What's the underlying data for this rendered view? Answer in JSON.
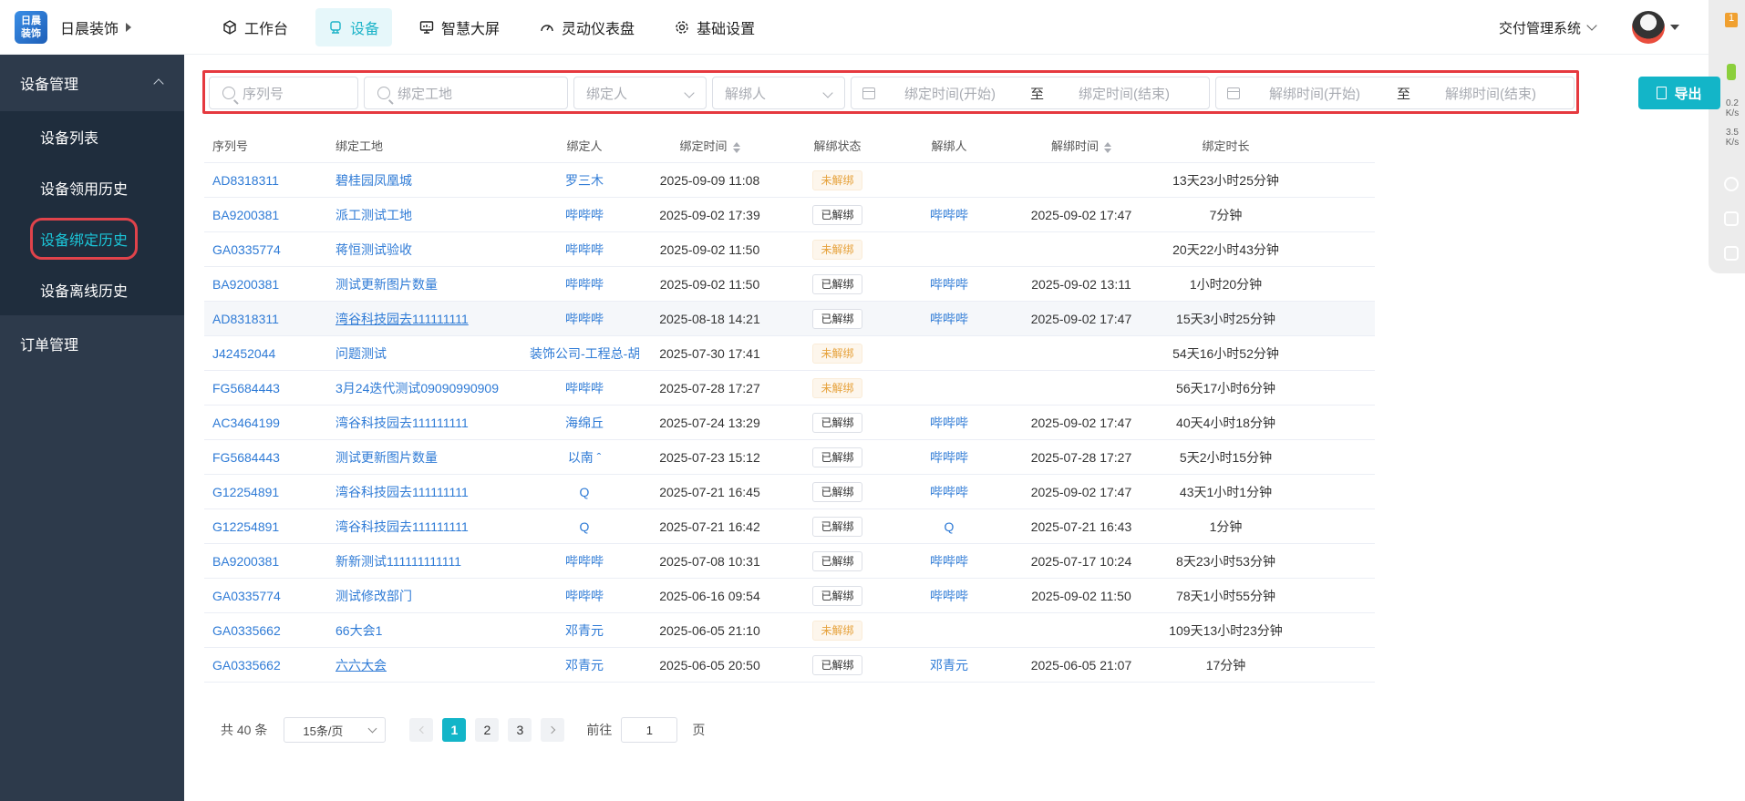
{
  "brand": {
    "name": "日晨装饰",
    "logo_text_1": "日晨",
    "logo_text_2": "装饰"
  },
  "nav": [
    {
      "label": "工作台",
      "icon": "cube-icon"
    },
    {
      "label": "设备",
      "icon": "device-icon",
      "active": true
    },
    {
      "label": "智慧大屏",
      "icon": "monitor-icon"
    },
    {
      "label": "灵动仪表盘",
      "icon": "gauge-icon"
    },
    {
      "label": "基础设置",
      "icon": "gear-icon"
    }
  ],
  "system_switch": "交付管理系统",
  "side_widget": {
    "badge": "1",
    "up_speed": "0.2",
    "up_unit": "K/s",
    "down_speed": "3.5",
    "down_unit": "K/s"
  },
  "sidebar": {
    "group1": "设备管理",
    "items": [
      "设备列表",
      "设备领用历史",
      "设备绑定历史",
      "设备离线历史"
    ],
    "group2": "订单管理"
  },
  "filters": {
    "serial_placeholder": "序列号",
    "site_placeholder": "绑定工地",
    "binder_placeholder": "绑定人",
    "unbinder_placeholder": "解绑人",
    "bind_start": "绑定时间(开始)",
    "bind_sep": "至",
    "bind_end": "绑定时间(结束)",
    "unbind_start": "解绑时间(开始)",
    "unbind_sep": "至",
    "unbind_end": "解绑时间(结束)"
  },
  "export_label": "导出",
  "table": {
    "headers": [
      "序列号",
      "绑定工地",
      "绑定人",
      "绑定时间",
      "解绑状态",
      "解绑人",
      "解绑时间",
      "绑定时长"
    ],
    "rows": [
      [
        "AD8318311",
        "碧桂园凤凰城",
        "罗三木",
        "2025-09-09 11:08",
        "未解绑",
        "",
        "",
        "13天23小时25分钟"
      ],
      [
        "BA9200381",
        "派工测试工地",
        "哔哔哔",
        "2025-09-02 17:39",
        "已解绑",
        "哔哔哔",
        "2025-09-02 17:47",
        "7分钟"
      ],
      [
        "GA0335774",
        "蒋恒测试验收",
        "哔哔哔",
        "2025-09-02 11:50",
        "未解绑",
        "",
        "",
        "20天22小时43分钟"
      ],
      [
        "BA9200381",
        "测试更新图片数量",
        "哔哔哔",
        "2025-09-02 11:50",
        "已解绑",
        "哔哔哔",
        "2025-09-02 13:11",
        "1小时20分钟"
      ],
      [
        "AD8318311",
        "湾谷科技园去111111111",
        "哔哔哔",
        "2025-08-18 14:21",
        "已解绑",
        "哔哔哔",
        "2025-09-02 17:47",
        "15天3小时25分钟"
      ],
      [
        "J42452044",
        "问题测试",
        "装饰公司-工程总-胡承仁",
        "2025-07-30 17:41",
        "未解绑",
        "",
        "",
        "54天16小时52分钟"
      ],
      [
        "FG5684443",
        "3月24迭代测试09090990909",
        "哔哔哔",
        "2025-07-28 17:27",
        "未解绑",
        "",
        "",
        "56天17小时6分钟"
      ],
      [
        "AC3464199",
        "湾谷科技园去111111111",
        "海绵丘",
        "2025-07-24 13:29",
        "已解绑",
        "哔哔哔",
        "2025-09-02 17:47",
        "40天4小时18分钟"
      ],
      [
        "FG5684443",
        "测试更新图片数量",
        "以南 ˆ",
        "2025-07-23 15:12",
        "已解绑",
        "哔哔哔",
        "2025-07-28 17:27",
        "5天2小时15分钟"
      ],
      [
        "G12254891",
        "湾谷科技园去111111111",
        "Q",
        "2025-07-21 16:45",
        "已解绑",
        "哔哔哔",
        "2025-09-02 17:47",
        "43天1小时1分钟"
      ],
      [
        "G12254891",
        "湾谷科技园去111111111",
        "Q",
        "2025-07-21 16:42",
        "已解绑",
        "Q",
        "2025-07-21 16:43",
        "1分钟"
      ],
      [
        "BA9200381",
        "新新测试111111111111",
        "哔哔哔",
        "2025-07-08 10:31",
        "已解绑",
        "哔哔哔",
        "2025-07-17 10:24",
        "8天23小时53分钟"
      ],
      [
        "GA0335774",
        "测试修改部门",
        "哔哔哔",
        "2025-06-16 09:54",
        "已解绑",
        "哔哔哔",
        "2025-09-02 11:50",
        "78天1小时55分钟"
      ],
      [
        "GA0335662",
        "66大会1",
        "邓青元",
        "2025-06-05 21:10",
        "未解绑",
        "",
        "",
        "109天13小时23分钟"
      ],
      [
        "GA0335662",
        "六六大会",
        "邓青元",
        "2025-06-05 20:50",
        "已解绑",
        "邓青元",
        "2025-06-05 21:07",
        "17分钟"
      ]
    ]
  },
  "pagination": {
    "total": "共 40 条",
    "page_size": "15条/页",
    "pages": [
      "1",
      "2",
      "3"
    ],
    "current": "1",
    "goto_prefix": "前往",
    "goto_value": "1",
    "goto_suffix": "页"
  },
  "colors": {
    "accent": "#13b5c8",
    "sidebar": "#2d3a4b",
    "link": "#2f7bd6",
    "highlight": "#e5393f"
  }
}
